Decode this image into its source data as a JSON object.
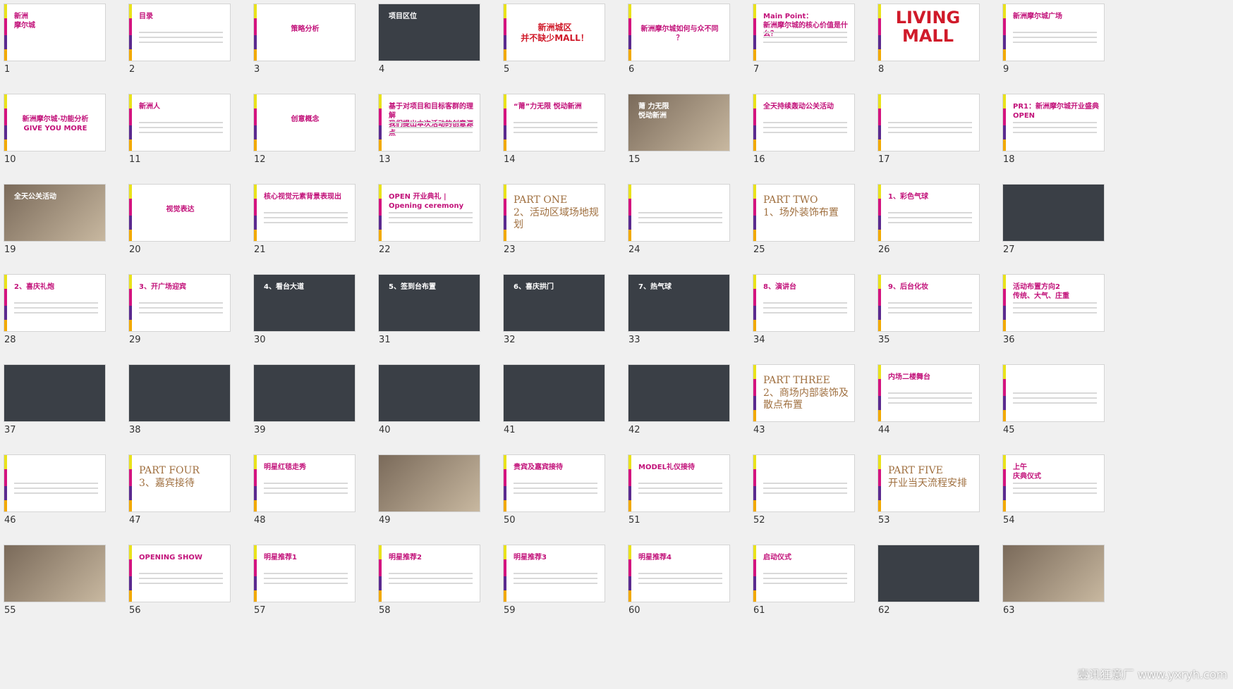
{
  "slides": [
    {
      "n": "1",
      "title": "新洲\n摩尔城",
      "style": "brand"
    },
    {
      "n": "2",
      "title": "目录",
      "style": "toc"
    },
    {
      "n": "3",
      "title": "策略分析",
      "style": "center"
    },
    {
      "n": "4",
      "title": "项目区位",
      "style": "dark"
    },
    {
      "n": "5",
      "title": "新洲城区\n并不缺少MALL！",
      "style": "red"
    },
    {
      "n": "6",
      "title": "新洲摩尔城如何与众不同\n？",
      "style": "center"
    },
    {
      "n": "7",
      "title": "Main Point：\n新洲摩尔城的核心价值是什么？",
      "style": "plain"
    },
    {
      "n": "8",
      "title": "LIVING\nMALL",
      "style": "big"
    },
    {
      "n": "9",
      "title": "新洲摩尔城广场",
      "style": "plain"
    },
    {
      "n": "10",
      "title": "新洲摩尔城·功能分析\nGIVE YOU MORE",
      "style": "center"
    },
    {
      "n": "11",
      "title": "新洲人",
      "style": "plain"
    },
    {
      "n": "12",
      "title": "创意概念",
      "style": "center"
    },
    {
      "n": "13",
      "title": "基于对项目和目标客群的理解\n我们提出本次活动的创意源点",
      "style": "plain"
    },
    {
      "n": "14",
      "title": "“莆”力无限 悦动新洲",
      "style": "plain"
    },
    {
      "n": "15",
      "title": "莆 力无限\n悦动新洲",
      "style": "photo"
    },
    {
      "n": "16",
      "title": "全天持续轰动公关活动",
      "style": "plain"
    },
    {
      "n": "17",
      "title": "",
      "style": "plain"
    },
    {
      "n": "18",
      "title": "PR1：新洲摩尔城开业盛典\nOPEN",
      "style": "plain"
    },
    {
      "n": "19",
      "title": "全天公关活动",
      "style": "photo"
    },
    {
      "n": "20",
      "title": "视觉表达",
      "style": "center"
    },
    {
      "n": "21",
      "title": "核心视觉元素背景表现出",
      "style": "plain"
    },
    {
      "n": "22",
      "title": "OPEN 开业典礼 | Opening ceremony",
      "style": "plain"
    },
    {
      "n": "23",
      "title": "PART ONE\n2、活动区域场地规划",
      "style": "part"
    },
    {
      "n": "24",
      "title": "",
      "style": "plain"
    },
    {
      "n": "25",
      "title": "PART TWO\n1、场外装饰布置",
      "style": "part"
    },
    {
      "n": "26",
      "title": "1、彩色气球",
      "style": "plain"
    },
    {
      "n": "27",
      "title": "",
      "style": "dark"
    },
    {
      "n": "28",
      "title": "2、喜庆礼炮",
      "style": "plain"
    },
    {
      "n": "29",
      "title": "3、开广场迎宾",
      "style": "plain"
    },
    {
      "n": "30",
      "title": "4、看台大道",
      "style": "dark"
    },
    {
      "n": "31",
      "title": "5、签到台布置",
      "style": "dark"
    },
    {
      "n": "32",
      "title": "6、喜庆拱门",
      "style": "dark"
    },
    {
      "n": "33",
      "title": "7、热气球",
      "style": "dark"
    },
    {
      "n": "34",
      "title": "8、演讲台",
      "style": "plain"
    },
    {
      "n": "35",
      "title": "9、后台化妆",
      "style": "plain"
    },
    {
      "n": "36",
      "title": "活动布置方向2\n传统、大气、庄重",
      "style": "plain"
    },
    {
      "n": "37",
      "title": "",
      "style": "dark"
    },
    {
      "n": "38",
      "title": "",
      "style": "dark"
    },
    {
      "n": "39",
      "title": "",
      "style": "dark"
    },
    {
      "n": "40",
      "title": "",
      "style": "dark"
    },
    {
      "n": "41",
      "title": "",
      "style": "dark"
    },
    {
      "n": "42",
      "title": "",
      "style": "dark"
    },
    {
      "n": "43",
      "title": "PART THREE\n2、商场内部装饰及散点布置",
      "style": "part"
    },
    {
      "n": "44",
      "title": "内场二楼舞台",
      "style": "plain"
    },
    {
      "n": "45",
      "title": "",
      "style": "plain"
    },
    {
      "n": "46",
      "title": "",
      "style": "plain"
    },
    {
      "n": "47",
      "title": "PART FOUR\n3、嘉宾接待",
      "style": "part"
    },
    {
      "n": "48",
      "title": "明星红毯走秀",
      "style": "plain"
    },
    {
      "n": "49",
      "title": "",
      "style": "photo"
    },
    {
      "n": "50",
      "title": "贵宾及嘉宾接待",
      "style": "plain"
    },
    {
      "n": "51",
      "title": "MODEL礼仪接待",
      "style": "plain"
    },
    {
      "n": "52",
      "title": "",
      "style": "plain"
    },
    {
      "n": "53",
      "title": "PART FIVE\n开业当天流程安排",
      "style": "part"
    },
    {
      "n": "54",
      "title": "上午\n庆典仪式",
      "style": "plain"
    },
    {
      "n": "55",
      "title": "",
      "style": "photo"
    },
    {
      "n": "56",
      "title": "OPENING SHOW",
      "style": "plain"
    },
    {
      "n": "57",
      "title": "明星推荐1",
      "style": "plain"
    },
    {
      "n": "58",
      "title": "明星推荐2",
      "style": "plain"
    },
    {
      "n": "59",
      "title": "明星推荐3",
      "style": "plain"
    },
    {
      "n": "60",
      "title": "明星推荐4",
      "style": "plain"
    },
    {
      "n": "61",
      "title": "启动仪式",
      "style": "plain"
    },
    {
      "n": "62",
      "title": "",
      "style": "dark"
    },
    {
      "n": "63",
      "title": "",
      "style": "photo"
    }
  ],
  "watermark": "壹讯狂意厂 www.yxryh.com"
}
